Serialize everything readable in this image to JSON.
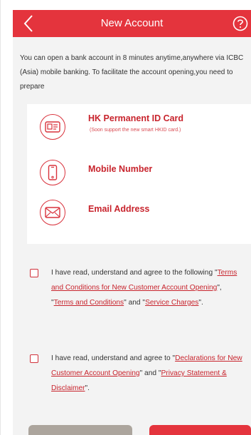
{
  "header": {
    "title": "New Account",
    "back_icon": "chevron-left-icon",
    "help_icon": "question-circle-icon"
  },
  "intro": {
    "text": "You can open a bank account in 8 minutes anytime,anywhere via ICBC (Asia) mobile banking. To facilitate the account opening,you need to prepare"
  },
  "requirements": [
    {
      "icon": "id-card-icon",
      "label": "HK Permanent ID Card",
      "note": "(Soon support the new smart HKID card.)"
    },
    {
      "icon": "mobile-phone-icon",
      "label": "Mobile Number"
    },
    {
      "icon": "envelope-icon",
      "label": "Email Address"
    }
  ],
  "agreements": [
    {
      "prefix": "I have read, understand and agree to the following \"",
      "link1": "Terms and Conditions for New Customer Account Opening",
      "mid1": "\", \"",
      "link2": "Terms and Conditions",
      "mid2": "\" and \"",
      "link3": "Service Charges",
      "suffix": "\"."
    },
    {
      "prefix": "I have read, understand and agree to \"",
      "link1": "Declarations for New Customer Account Opening",
      "mid1": "\" and \"",
      "link2": "Privacy Statement & Disclaimer",
      "suffix": "\"."
    }
  ],
  "colors": {
    "accent": "#e4343d",
    "link": "#c8242d",
    "secondary_button": "#aca59d",
    "background": "#f3f3f3"
  }
}
